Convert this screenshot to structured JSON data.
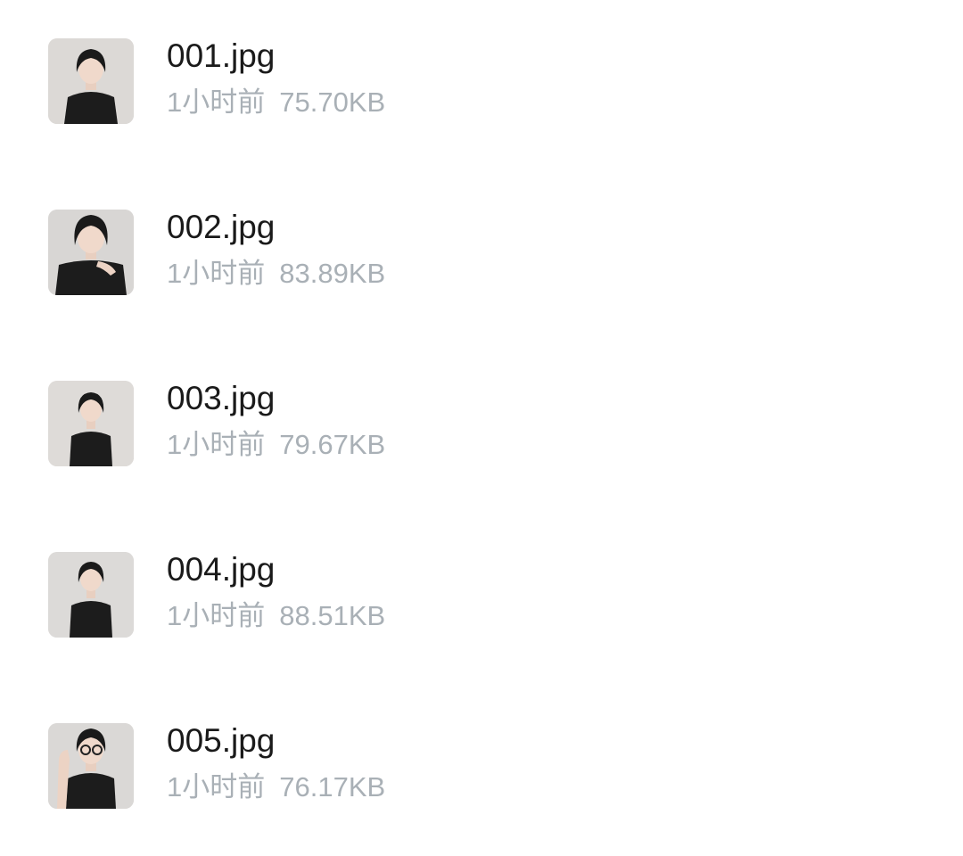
{
  "files": [
    {
      "name": "001.jpg",
      "time": "1小时前",
      "size": "75.70KB",
      "thumb_icon": "portrait-photo-thumbnail"
    },
    {
      "name": "002.jpg",
      "time": "1小时前",
      "size": "83.89KB",
      "thumb_icon": "portrait-photo-thumbnail"
    },
    {
      "name": "003.jpg",
      "time": "1小时前",
      "size": "79.67KB",
      "thumb_icon": "portrait-photo-thumbnail"
    },
    {
      "name": "004.jpg",
      "time": "1小时前",
      "size": "88.51KB",
      "thumb_icon": "portrait-photo-thumbnail"
    },
    {
      "name": "005.jpg",
      "time": "1小时前",
      "size": "76.17KB",
      "thumb_icon": "portrait-photo-thumbnail"
    }
  ],
  "colors": {
    "name_text": "#1a1a1a",
    "meta_text": "#a9b0b6",
    "background": "#ffffff"
  }
}
